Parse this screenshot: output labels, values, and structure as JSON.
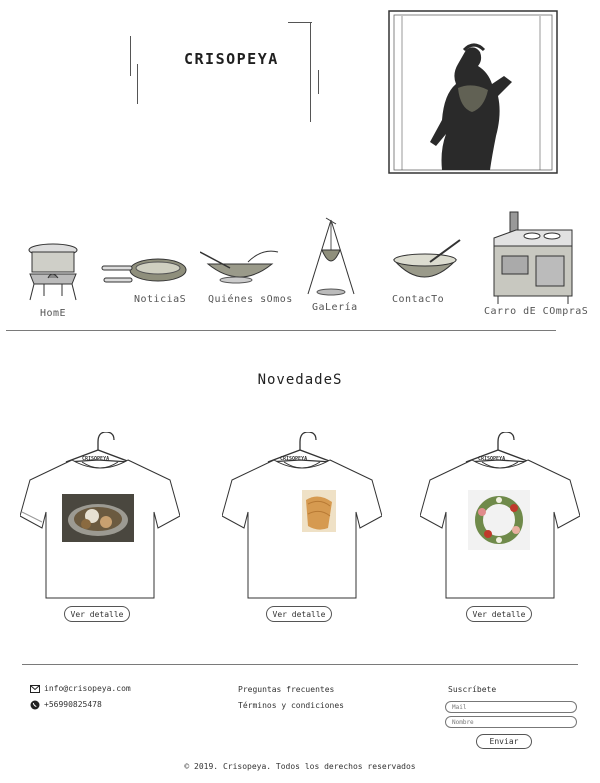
{
  "header": {
    "brand": "CRISOPEYA"
  },
  "nav": [
    {
      "label": "HomE",
      "icon": "pot-on-stove-icon"
    },
    {
      "label": "NoticiaS",
      "icon": "frying-pan-icon"
    },
    {
      "label": "Quiénes sOmos",
      "icon": "mixing-bowl-icon"
    },
    {
      "label": "GaLería",
      "icon": "tripod-pot-icon"
    },
    {
      "label": "ContacTo",
      "icon": "bowl-ladle-icon"
    },
    {
      "label": "Carro dE COmpraS",
      "icon": "wood-stove-icon"
    }
  ],
  "section": {
    "title": "NovedadeS"
  },
  "products": [
    {
      "tag": "CRISOPEYA",
      "button": "Ver detalle",
      "photo": "bowl-of-stew"
    },
    {
      "tag": "CRISOPEYA",
      "button": "Ver detalle",
      "photo": "bread-loaves"
    },
    {
      "tag": "CRISOPEYA",
      "button": "Ver detalle",
      "photo": "wreath-plate"
    }
  ],
  "footer": {
    "email": "info@crisopeya.com",
    "phone": "+56990825478",
    "links": [
      "Preguntas frecuentes",
      "Términos y condiciones"
    ],
    "subscribe_title": "Suscríbete",
    "mail_placeholder": "Mail",
    "name_placeholder": "Nombre",
    "send_label": "Enviar",
    "copyright": "© 2019. Crisopeya. Todos los derechos reservados"
  },
  "colors": {
    "text": "#2b2b2b",
    "line": "#7a7a7a",
    "sketch": "#555555"
  }
}
